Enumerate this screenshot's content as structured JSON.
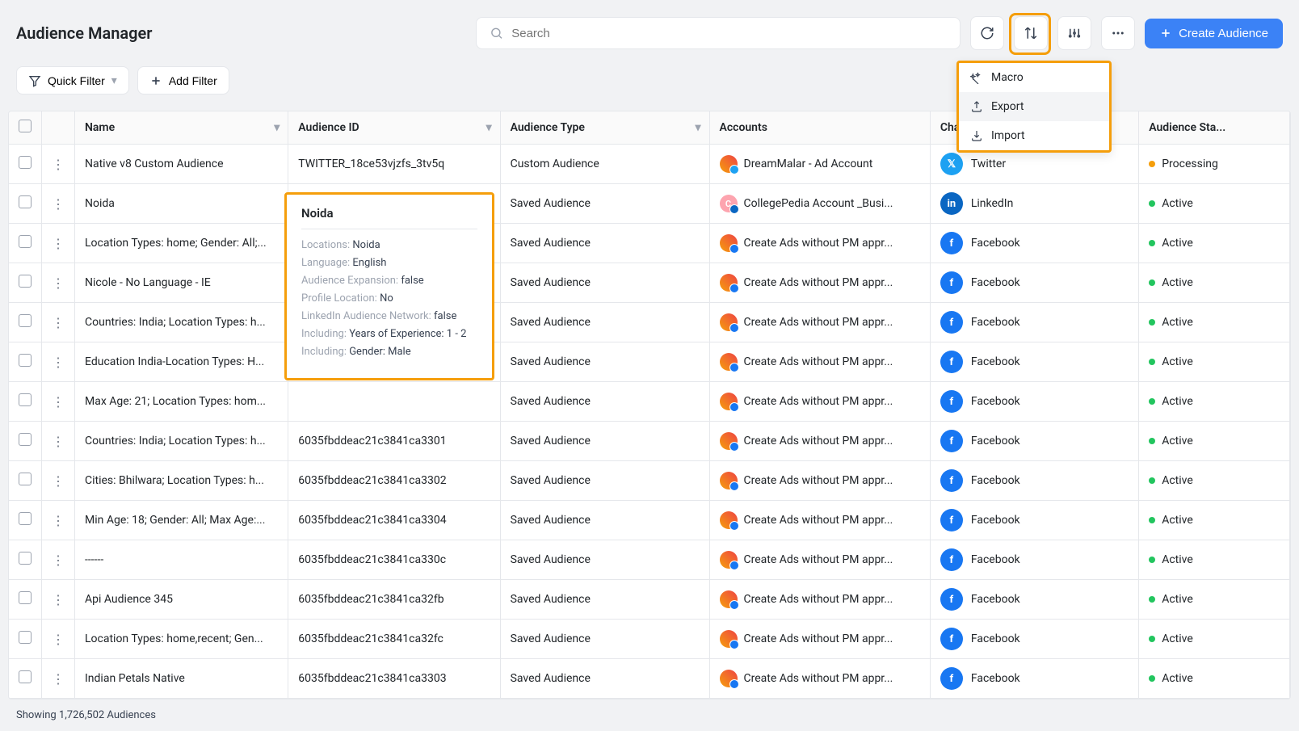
{
  "header": {
    "title": "Audience Manager",
    "search_placeholder": "Search",
    "create_label": "Create Audience"
  },
  "filters": {
    "quick_filter": "Quick Filter",
    "add_filter": "Add Filter"
  },
  "columns": {
    "name": "Name",
    "audience_id": "Audience ID",
    "audience_type": "Audience Type",
    "accounts": "Accounts",
    "channel": "Cha...",
    "status": "Audience Sta..."
  },
  "dropdown": {
    "macro": "Macro",
    "export": "Export",
    "import": "Import"
  },
  "tooltip": {
    "title": "Noida",
    "rows": [
      {
        "label": "Locations:",
        "value": "Noida"
      },
      {
        "label": "Language:",
        "value": "English"
      },
      {
        "label": "Audience Expansion:",
        "value": "false"
      },
      {
        "label": "Profile Location:",
        "value": "No"
      },
      {
        "label": "LinkedIn Audience Network:",
        "value": "false"
      },
      {
        "label": "Including:",
        "value": "Years of Experience: 1 - 2"
      },
      {
        "label": "Including:",
        "value": "Gender: Male"
      }
    ]
  },
  "rows": [
    {
      "name": "Native v8 Custom Audience",
      "id": "TWITTER_18ce53vjzfs_3tv5q",
      "type": "Custom Audience",
      "account": "DreamMalar - Ad Account",
      "channel": "Twitter",
      "channel_color": "#1da1f2",
      "avatar_bg": "linear-gradient(45deg,#f59e0b,#ef4444)",
      "avatar_text": "",
      "badge_color": "#1da1f2",
      "status": "Processing",
      "status_color": "#f59e0b"
    },
    {
      "name": "Noida",
      "id": "",
      "type": "Saved Audience",
      "account": "CollegePedia Account _Busi...",
      "channel": "LinkedIn",
      "channel_color": "#0a66c2",
      "avatar_bg": "#fda4af",
      "avatar_text": "C",
      "badge_color": "#0a66c2",
      "status": "Active",
      "status_color": "#22c55e"
    },
    {
      "name": "Location Types: home; Gender: All;...",
      "id": "",
      "type": "Saved Audience",
      "account": "Create Ads without PM appr...",
      "channel": "Facebook",
      "channel_color": "#1877f2",
      "avatar_bg": "linear-gradient(45deg,#f59e0b,#ef4444)",
      "avatar_text": "",
      "badge_color": "#1877f2",
      "status": "Active",
      "status_color": "#22c55e"
    },
    {
      "name": "Nicole - No Language - IE",
      "id": "",
      "type": "Saved Audience",
      "account": "Create Ads without PM appr...",
      "channel": "Facebook",
      "channel_color": "#1877f2",
      "avatar_bg": "linear-gradient(45deg,#f59e0b,#ef4444)",
      "avatar_text": "",
      "badge_color": "#1877f2",
      "status": "Active",
      "status_color": "#22c55e"
    },
    {
      "name": "Countries: India; Location Types: h...",
      "id": "",
      "type": "Saved Audience",
      "account": "Create Ads without PM appr...",
      "channel": "Facebook",
      "channel_color": "#1877f2",
      "avatar_bg": "linear-gradient(45deg,#f59e0b,#ef4444)",
      "avatar_text": "",
      "badge_color": "#1877f2",
      "status": "Active",
      "status_color": "#22c55e"
    },
    {
      "name": "Education India-Location Types: H...",
      "id": "",
      "type": "Saved Audience",
      "account": "Create Ads without PM appr...",
      "channel": "Facebook",
      "channel_color": "#1877f2",
      "avatar_bg": "linear-gradient(45deg,#f59e0b,#ef4444)",
      "avatar_text": "",
      "badge_color": "#1877f2",
      "status": "Active",
      "status_color": "#22c55e"
    },
    {
      "name": "Max Age: 21; Location Types: hom...",
      "id": "",
      "type": "Saved Audience",
      "account": "Create Ads without PM appr...",
      "channel": "Facebook",
      "channel_color": "#1877f2",
      "avatar_bg": "linear-gradient(45deg,#f59e0b,#ef4444)",
      "avatar_text": "",
      "badge_color": "#1877f2",
      "status": "Active",
      "status_color": "#22c55e"
    },
    {
      "name": "Countries: India; Location Types: h...",
      "id": "6035fbddeac21c3841ca3301",
      "type": "Saved Audience",
      "account": "Create Ads without PM appr...",
      "channel": "Facebook",
      "channel_color": "#1877f2",
      "avatar_bg": "linear-gradient(45deg,#f59e0b,#ef4444)",
      "avatar_text": "",
      "badge_color": "#1877f2",
      "status": "Active",
      "status_color": "#22c55e"
    },
    {
      "name": "Cities: Bhilwara; Location Types: h...",
      "id": "6035fbddeac21c3841ca3302",
      "type": "Saved Audience",
      "account": "Create Ads without PM appr...",
      "channel": "Facebook",
      "channel_color": "#1877f2",
      "avatar_bg": "linear-gradient(45deg,#f59e0b,#ef4444)",
      "avatar_text": "",
      "badge_color": "#1877f2",
      "status": "Active",
      "status_color": "#22c55e"
    },
    {
      "name": "Min Age: 18; Gender: All; Max Age:...",
      "id": "6035fbddeac21c3841ca3304",
      "type": "Saved Audience",
      "account": "Create Ads without PM appr...",
      "channel": "Facebook",
      "channel_color": "#1877f2",
      "avatar_bg": "linear-gradient(45deg,#f59e0b,#ef4444)",
      "avatar_text": "",
      "badge_color": "#1877f2",
      "status": "Active",
      "status_color": "#22c55e"
    },
    {
      "name": "------",
      "id": "6035fbddeac21c3841ca330c",
      "type": "Saved Audience",
      "account": "Create Ads without PM appr...",
      "channel": "Facebook",
      "channel_color": "#1877f2",
      "avatar_bg": "linear-gradient(45deg,#f59e0b,#ef4444)",
      "avatar_text": "",
      "badge_color": "#1877f2",
      "status": "Active",
      "status_color": "#22c55e"
    },
    {
      "name": "Api Audience 345",
      "id": "6035fbddeac21c3841ca32fb",
      "type": "Saved Audience",
      "account": "Create Ads without PM appr...",
      "channel": "Facebook",
      "channel_color": "#1877f2",
      "avatar_bg": "linear-gradient(45deg,#f59e0b,#ef4444)",
      "avatar_text": "",
      "badge_color": "#1877f2",
      "status": "Active",
      "status_color": "#22c55e"
    },
    {
      "name": "Location Types: home,recent; Gen...",
      "id": "6035fbddeac21c3841ca32fc",
      "type": "Saved Audience",
      "account": "Create Ads without PM appr...",
      "channel": "Facebook",
      "channel_color": "#1877f2",
      "avatar_bg": "linear-gradient(45deg,#f59e0b,#ef4444)",
      "avatar_text": "",
      "badge_color": "#1877f2",
      "status": "Active",
      "status_color": "#22c55e"
    },
    {
      "name": "Indian Petals Native",
      "id": "6035fbddeac21c3841ca3303",
      "type": "Saved Audience",
      "account": "Create Ads without PM appr...",
      "channel": "Facebook",
      "channel_color": "#1877f2",
      "avatar_bg": "linear-gradient(45deg,#f59e0b,#ef4444)",
      "avatar_text": "",
      "badge_color": "#1877f2",
      "status": "Active",
      "status_color": "#22c55e"
    }
  ],
  "footer": {
    "showing": "Showing 1,726,502 Audiences"
  }
}
